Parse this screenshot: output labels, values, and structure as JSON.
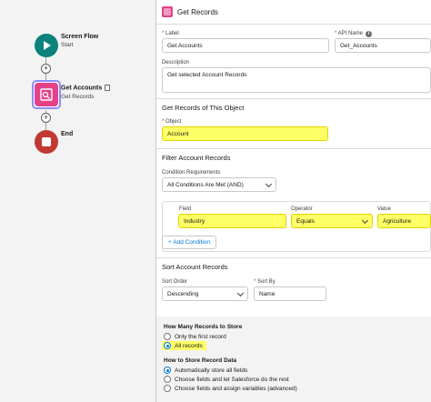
{
  "canvas": {
    "start": {
      "title": "Screen Flow",
      "subtitle": "Start"
    },
    "get_records": {
      "title": "Get Accounts",
      "subtitle": "Get Records"
    },
    "end": {
      "title": "End"
    },
    "add_symbol": "+"
  },
  "panel": {
    "title": "Get Records",
    "label": {
      "label": "Label",
      "value": "Get Accounts"
    },
    "api_name": {
      "label": "API Name",
      "value": "Get_Accounts"
    },
    "description": {
      "label": "Description",
      "value": "Get selected Account Records"
    }
  },
  "object_section": {
    "title": "Get Records of This Object",
    "object_label": "Object",
    "object_value": "Account"
  },
  "filter_section": {
    "title": "Filter Account Records",
    "condition_label": "Condition Requirements",
    "condition_value": "All Conditions Are Met (AND)",
    "field_label": "Field",
    "field_value": "Industry",
    "operator_label": "Operator",
    "operator_value": "Equals",
    "value_label": "Value",
    "value_value": "Agriculture",
    "add_condition": "+ Add Condition"
  },
  "sort_section": {
    "title": "Sort Account Records",
    "order_label": "Sort Order",
    "order_value": "Descending",
    "sort_by_label": "Sort By",
    "sort_by_value": "Name"
  },
  "store_section": {
    "how_many_title": "How Many Records to Store",
    "opt_first": "Only the first record",
    "opt_all": "All records",
    "how_store_title": "How to Store Record Data",
    "opt_auto": "Automatically store all fields",
    "opt_choose_sf": "Choose fields and let Salesforce do the rest",
    "opt_choose_assign": "Choose fields and assign variables (advanced)"
  },
  "colors": {
    "start_node": "#0b827c",
    "get_node": "#e3428b",
    "end_node": "#c23934",
    "highlight": "#ffff66",
    "link": "#0176d3"
  }
}
